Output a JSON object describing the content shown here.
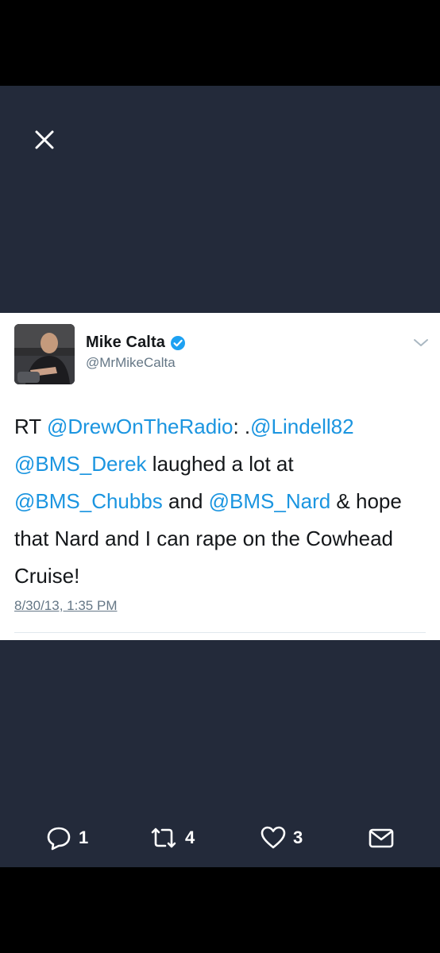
{
  "tweet": {
    "author_name": "Mike Calta",
    "author_handle": "@MrMikeCalta",
    "verified": true,
    "text_segments": [
      {
        "text": "RT ",
        "type": "text"
      },
      {
        "text": "@DrewOnTheRadio",
        "type": "mention"
      },
      {
        "text": ": .",
        "type": "text"
      },
      {
        "text": "@Lindell82",
        "type": "mention"
      },
      {
        "text": " ",
        "type": "text"
      },
      {
        "text": "@BMS_Derek",
        "type": "mention"
      },
      {
        "text": " laughed a lot at ",
        "type": "text"
      },
      {
        "text": "@BMS_Chubbs",
        "type": "mention"
      },
      {
        "text": " and ",
        "type": "text"
      },
      {
        "text": "@BMS_Nard",
        "type": "mention"
      },
      {
        "text": " & hope that Nard and I can rape on the Cowhead Cruise!",
        "type": "text"
      }
    ],
    "timestamp": "8/30/13, 1:35 PM"
  },
  "actions": {
    "reply_count": "1",
    "retweet_count": "4",
    "like_count": "3"
  },
  "colors": {
    "background": "#232a3a",
    "card": "#ffffff",
    "mention": "#1b95e0",
    "verified": "#1da1f2",
    "secondary_text": "#657786"
  },
  "icons": [
    "close-icon",
    "verified-badge-icon",
    "chevron-down-icon",
    "reply-icon",
    "retweet-icon",
    "like-icon",
    "message-icon"
  ]
}
